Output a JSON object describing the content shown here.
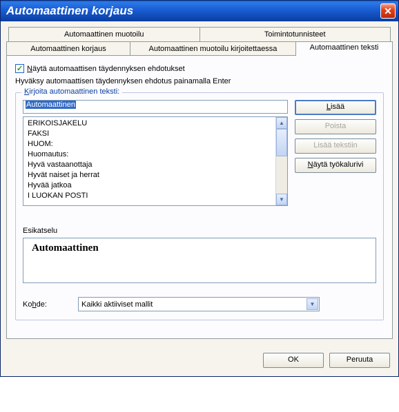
{
  "window": {
    "title": "Automaattinen korjaus"
  },
  "tabs": {
    "row1": [
      {
        "label": "Automaattinen muotoilu"
      },
      {
        "label": "Toimintotunnisteet"
      }
    ],
    "row2": [
      {
        "label": "Automaattinen korjaus"
      },
      {
        "label": "Automaattinen muotoilu kirjoitettaessa"
      },
      {
        "label": "Automaattinen teksti"
      }
    ]
  },
  "checkbox": {
    "label_pre": "N",
    "label_rest": "äytä automaattisen täydennyksen ehdotukset"
  },
  "hint": "Hyväksy automaattisen täydennyksen ehdotus painamalla Enter",
  "group": {
    "legend_pre": "K",
    "legend_rest": "irjoita automaattinen teksti:"
  },
  "input_value": "Automaattinen",
  "list": [
    "ERIKOISJAKELU",
    "FAKSI",
    "HUOM:",
    "Huomautus:",
    "Hyvä vastaanottaja",
    "Hyvät naiset ja herrat",
    "Hyvää jatkoa",
    "I LUOKAN POSTI"
  ],
  "buttons": {
    "add_pre": "L",
    "add_rest": "isää",
    "delete": "Poista",
    "insert": "Lisää tekstiin",
    "toolbar_pre": "N",
    "toolbar_rest": "äytä työkalurivi"
  },
  "preview": {
    "label": "Esikatselu",
    "text": "Automaattinen"
  },
  "target": {
    "label_pre": "Ko",
    "label_u": "h",
    "label_post": "de:",
    "value": "Kaikki aktiiviset mallit"
  },
  "footer": {
    "ok": "OK",
    "cancel": "Peruuta"
  }
}
